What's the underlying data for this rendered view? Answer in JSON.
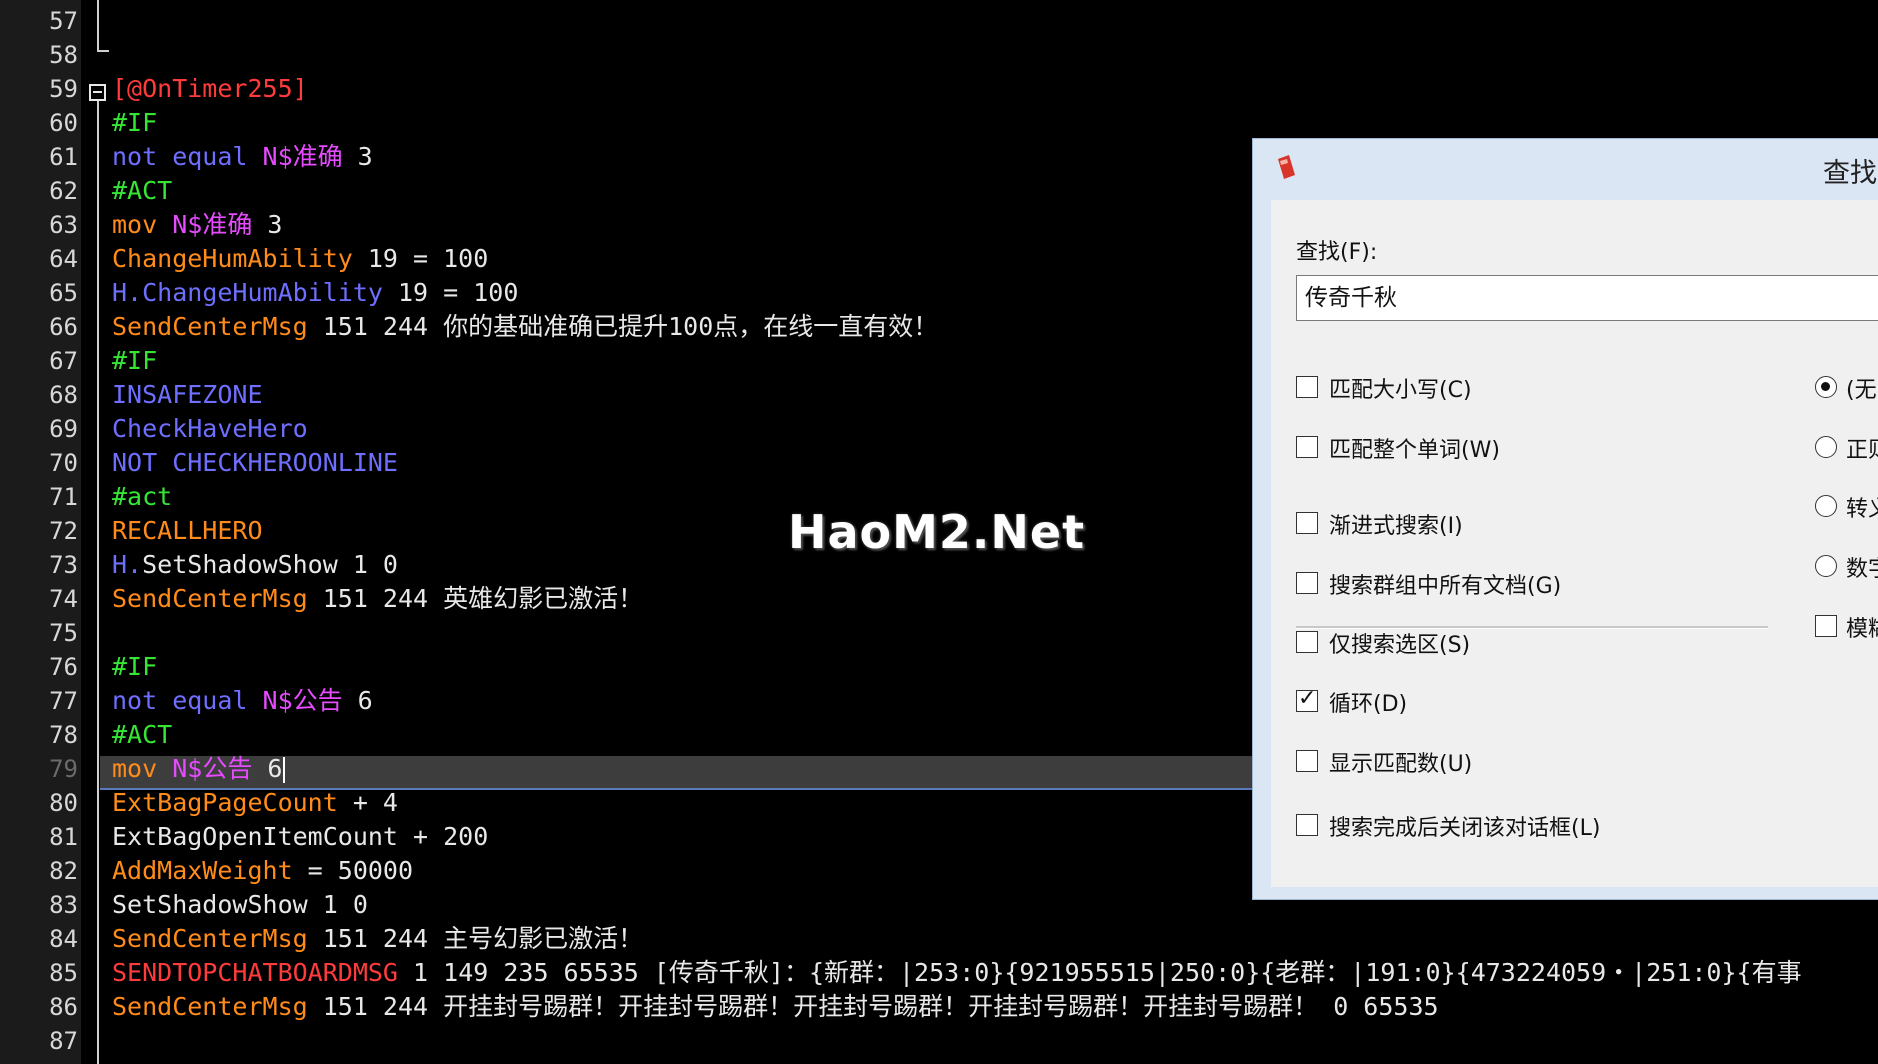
{
  "editor": {
    "lines": [
      {
        "n": "57",
        "tokens": []
      },
      {
        "n": "58",
        "tokens": []
      },
      {
        "n": "59",
        "tokens": [
          {
            "t": "[@OnTimer255]",
            "c": "red"
          }
        ]
      },
      {
        "n": "60",
        "tokens": [
          {
            "t": "#IF",
            "c": "green"
          }
        ]
      },
      {
        "n": "61",
        "tokens": [
          {
            "t": "not equal ",
            "c": "blue"
          },
          {
            "t": "N$准确",
            "c": "mag"
          },
          {
            "t": " 3",
            "c": "white"
          }
        ]
      },
      {
        "n": "62",
        "tokens": [
          {
            "t": "#ACT",
            "c": "green"
          }
        ]
      },
      {
        "n": "63",
        "tokens": [
          {
            "t": "mov ",
            "c": "orange"
          },
          {
            "t": "N$准确",
            "c": "mag"
          },
          {
            "t": " 3",
            "c": "white"
          }
        ]
      },
      {
        "n": "64",
        "tokens": [
          {
            "t": "ChangeHumAbility",
            "c": "orange"
          },
          {
            "t": " 19 = 100",
            "c": "white"
          }
        ]
      },
      {
        "n": "65",
        "tokens": [
          {
            "t": "H.",
            "c": "blue"
          },
          {
            "t": "ChangeHumAbility",
            "c": "blue"
          },
          {
            "t": " 19 = 100",
            "c": "white"
          }
        ]
      },
      {
        "n": "66",
        "tokens": [
          {
            "t": "SendCenterMsg",
            "c": "orange"
          },
          {
            "t": " 151 244 你的基础准确已提升100点，在线一直有效！",
            "c": "white"
          }
        ]
      },
      {
        "n": "67",
        "tokens": [
          {
            "t": "#IF",
            "c": "green"
          }
        ]
      },
      {
        "n": "68",
        "tokens": [
          {
            "t": "INSAFEZONE",
            "c": "blue"
          }
        ]
      },
      {
        "n": "69",
        "tokens": [
          {
            "t": "CheckHaveHero",
            "c": "blue"
          }
        ]
      },
      {
        "n": "70",
        "tokens": [
          {
            "t": "NOT CHECKHEROONLINE",
            "c": "blue"
          }
        ]
      },
      {
        "n": "71",
        "tokens": [
          {
            "t": "#act",
            "c": "green"
          }
        ]
      },
      {
        "n": "72",
        "tokens": [
          {
            "t": "RECALLHERO",
            "c": "orange"
          }
        ]
      },
      {
        "n": "73",
        "tokens": [
          {
            "t": "H.",
            "c": "blue"
          },
          {
            "t": "SetShadowShow 1 0",
            "c": "white"
          }
        ]
      },
      {
        "n": "74",
        "tokens": [
          {
            "t": "SendCenterMsg",
            "c": "orange"
          },
          {
            "t": " 151 244 英雄幻影已激活！",
            "c": "white"
          }
        ]
      },
      {
        "n": "75",
        "tokens": []
      },
      {
        "n": "76",
        "tokens": [
          {
            "t": "#IF",
            "c": "green"
          }
        ]
      },
      {
        "n": "77",
        "tokens": [
          {
            "t": "not equal ",
            "c": "blue"
          },
          {
            "t": "N$公告",
            "c": "mag"
          },
          {
            "t": " 6",
            "c": "white"
          }
        ]
      },
      {
        "n": "78",
        "tokens": [
          {
            "t": "#ACT",
            "c": "green"
          }
        ]
      },
      {
        "n": "79",
        "tokens": [
          {
            "t": "mov ",
            "c": "orange"
          },
          {
            "t": "N$公告",
            "c": "mag"
          },
          {
            "t": " 6",
            "c": "white"
          }
        ],
        "current": true
      },
      {
        "n": "80",
        "tokens": [
          {
            "t": "ExtBagPageCount",
            "c": "orange"
          },
          {
            "t": " + 4",
            "c": "white"
          }
        ]
      },
      {
        "n": "81",
        "tokens": [
          {
            "t": "ExtBagOpenItemCount + 200",
            "c": "white"
          }
        ]
      },
      {
        "n": "82",
        "tokens": [
          {
            "t": "AddMaxWeight",
            "c": "orange"
          },
          {
            "t": " = 50000",
            "c": "white"
          }
        ]
      },
      {
        "n": "83",
        "tokens": [
          {
            "t": "SetShadowShow 1 0",
            "c": "white"
          }
        ]
      },
      {
        "n": "84",
        "tokens": [
          {
            "t": "SendCenterMsg",
            "c": "orange"
          },
          {
            "t": " 151 244 主号幻影已激活！",
            "c": "white"
          }
        ]
      },
      {
        "n": "85",
        "tokens": [
          {
            "t": "SENDTOPCHATBOARDMSG",
            "c": "red"
          },
          {
            "t": " 1 149 235 65535 [传奇千秋]：{新群：|253:0}{921955515|250:0}{老群：|191:0}{473224059・|251:0}{有事",
            "c": "white"
          }
        ]
      },
      {
        "n": "86",
        "tokens": [
          {
            "t": "SendCenterMsg",
            "c": "orange"
          },
          {
            "t": " 151 244 开挂封号踢群！开挂封号踢群！开挂封号踢群！开挂封号踢群！开挂封号踢群！ 0 65535",
            "c": "white"
          }
        ]
      },
      {
        "n": "87",
        "tokens": []
      }
    ]
  },
  "watermark": "HaoM2.Net",
  "find_dialog": {
    "title": "查找",
    "find_label": "查找(F):",
    "find_value": "传奇千秋",
    "options": {
      "match_case": {
        "label": "匹配大小写(C)",
        "checked": false
      },
      "whole_word": {
        "label": "匹配整个单词(W)",
        "checked": false
      },
      "incremental": {
        "label": "渐进式搜索(I)",
        "checked": false
      },
      "all_docs": {
        "label": "搜索群组中所有文档(G)",
        "checked": false
      },
      "selection_only": {
        "label": "仅搜索选区(S)",
        "checked": false
      },
      "wrap": {
        "label": "循环(D)",
        "checked": true
      },
      "show_count": {
        "label": "显示匹配数(U)",
        "checked": false
      },
      "close_after": {
        "label": "搜索完成后关闭该对话框(L)",
        "checked": false
      }
    },
    "modes": [
      {
        "label": "(无",
        "selected": true
      },
      {
        "label": "正则",
        "selected": false
      },
      {
        "label": "转义",
        "selected": false
      },
      {
        "label": "数字",
        "selected": false
      }
    ],
    "fuzzy": {
      "label": "模糊",
      "checked": false
    }
  },
  "colors": {
    "red": "#ff3b3b",
    "green": "#35e635",
    "blue": "#6f6fff",
    "mag": "#e64bff",
    "orange": "#ff8c1a",
    "white": "#e8e8e8"
  }
}
